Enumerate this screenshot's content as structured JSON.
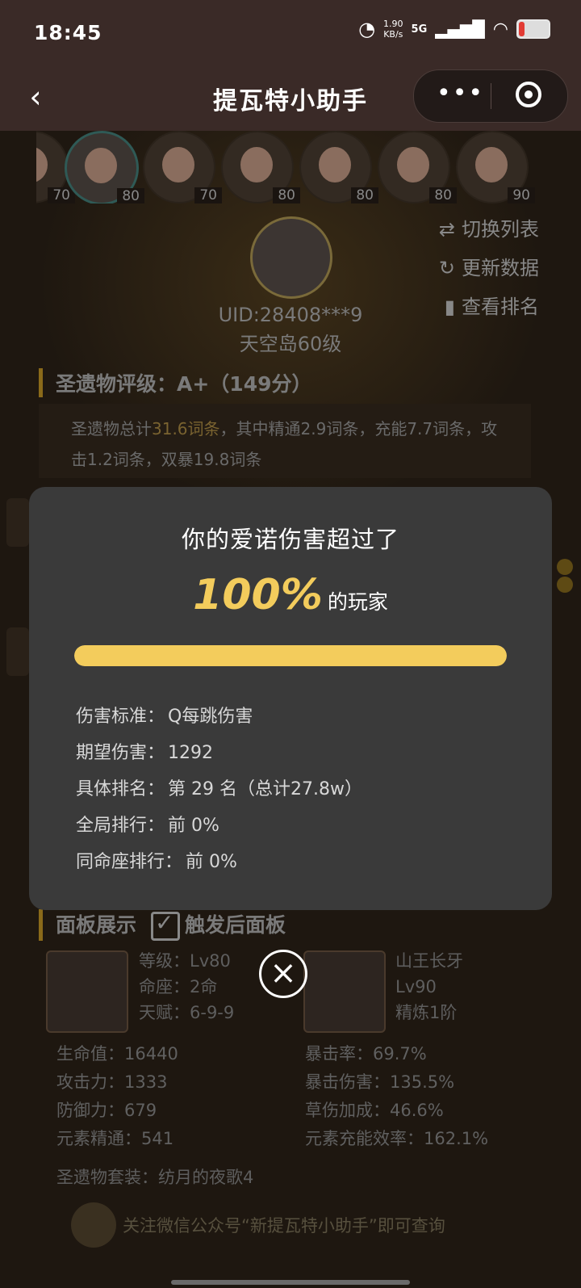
{
  "status": {
    "time": "18:45",
    "speed_value": "1.90",
    "speed_unit": "KB/s",
    "network": "5G"
  },
  "titlebar": {
    "title": "提瓦特小助手"
  },
  "characters": [
    {
      "level": "70"
    },
    {
      "level": "80"
    },
    {
      "level": "70"
    },
    {
      "level": "80"
    },
    {
      "level": "80"
    },
    {
      "level": "80"
    },
    {
      "level": "90"
    }
  ],
  "side_actions": {
    "switch_list": "切换列表",
    "refresh": "更新数据",
    "ranking": "查看排名"
  },
  "profile": {
    "uid": "UID:28408***9",
    "island": "天空岛60级"
  },
  "artifact_rating": {
    "title": "圣遗物评级：A+（149分）",
    "summary_pre": "圣遗物总计",
    "total": "31.6词条",
    "summary_post": "，其中精通2.9词条，充能7.7词条，攻击1.2词条，双暴19.8词条"
  },
  "panel": {
    "title": "面板展示",
    "toggle_label": "触发后面板",
    "char_info": {
      "level": "等级：Lv80",
      "constellation": "命座：2命",
      "talent": "天赋：6-9-9"
    },
    "weapon": {
      "name": "山王长牙",
      "level": "Lv90",
      "refine": "精炼1阶"
    },
    "stats_left": [
      "生命值：16440",
      "攻击力：1333",
      "防御力：679",
      "元素精通：541"
    ],
    "stats_right": [
      "暴击率：69.7%",
      "暴击伤害：135.5%",
      "草伤加成：46.6%",
      "元素充能效率：162.1%"
    ],
    "artifact_set": "圣遗物套装：纺月的夜歌4"
  },
  "footer": {
    "text": "关注微信公众号“新提瓦特小助手”即可查询"
  },
  "modal": {
    "headline": "你的爱诺伤害超过了",
    "percent": "100%",
    "percent_suffix": "的玩家",
    "progress": 1.0,
    "lines": [
      {
        "label": "伤害标准：",
        "value": "Q每跳伤害"
      },
      {
        "label": "期望伤害：",
        "value": "1292"
      },
      {
        "label": "具体排名：",
        "value": "第 29 名（总计27.8w）"
      },
      {
        "label": "全局排行：",
        "value": "前 0%"
      },
      {
        "label": "同命座排行：",
        "value": "前 0%"
      }
    ]
  },
  "colors": {
    "accent": "#f3cc5c",
    "modal_bg": "#3a3a3a",
    "titlebar_bg": "#3a2a27"
  }
}
